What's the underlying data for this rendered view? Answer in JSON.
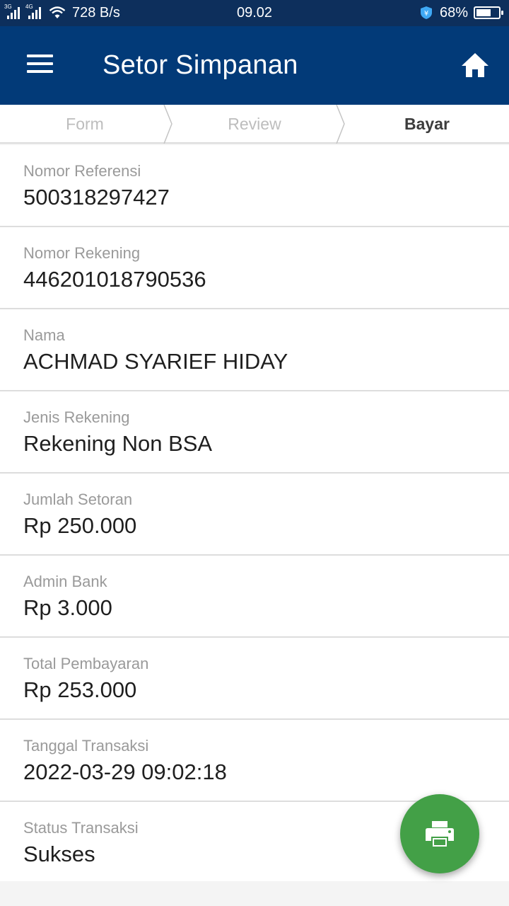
{
  "status_bar": {
    "network_1": "3G",
    "network_2": "4G",
    "speed": "728 B/s",
    "time": "09.02",
    "battery_percent": "68%",
    "battery_level": 0.68
  },
  "app_bar": {
    "title": "Setor Simpanan"
  },
  "steps": [
    {
      "label": "Form",
      "active": false
    },
    {
      "label": "Review",
      "active": false
    },
    {
      "label": "Bayar",
      "active": true
    }
  ],
  "details": [
    {
      "label": "Nomor Referensi",
      "value": "500318297427"
    },
    {
      "label": "Nomor Rekening",
      "value": "446201018790536"
    },
    {
      "label": "Nama",
      "value": "ACHMAD SYARIEF HIDAY"
    },
    {
      "label": "Jenis Rekening",
      "value": "Rekening Non BSA"
    },
    {
      "label": "Jumlah Setoran",
      "value": "Rp 250.000"
    },
    {
      "label": "Admin Bank",
      "value": "Rp 3.000"
    },
    {
      "label": "Total Pembayaran",
      "value": "Rp 253.000"
    },
    {
      "label": "Tanggal Transaksi",
      "value": "2022-03-29 09:02:18"
    },
    {
      "label": "Status Transaksi",
      "value": "Sukses"
    }
  ],
  "colors": {
    "app_bar": "#023a78",
    "status_bar": "#0d2f5c",
    "fab": "#43a047"
  },
  "icons": {
    "menu": "hamburger-menu-icon",
    "home": "home-icon",
    "print": "printer-icon"
  }
}
